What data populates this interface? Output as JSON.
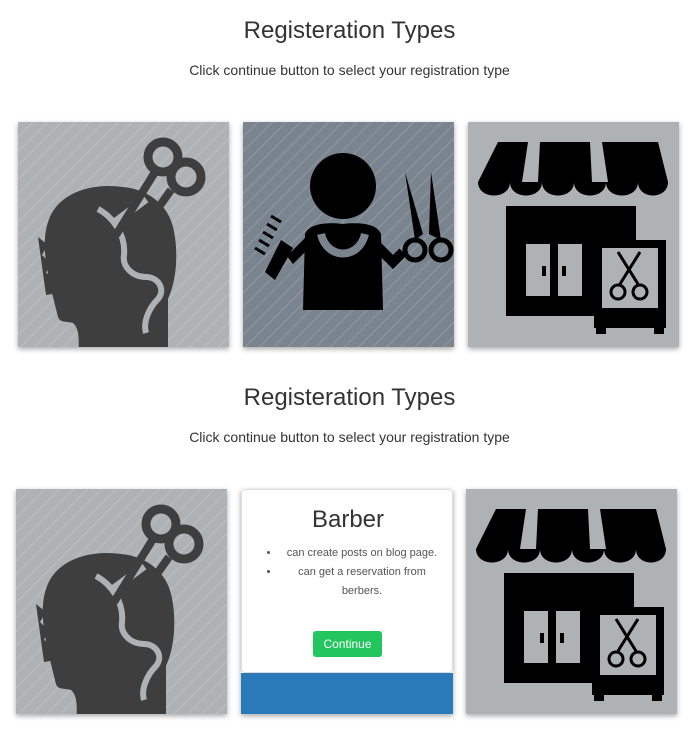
{
  "sections": [
    {
      "title": "Registeration Types",
      "subtitle": "Click continue button to select your registration type",
      "cards": [
        {
          "icon": "hairstyle-head-scissors-icon",
          "bg": "#aeb2b4"
        },
        {
          "icon": "barber-comb-scissors-icon",
          "bg": "#7a848e"
        },
        {
          "icon": "barbershop-storefront-icon",
          "bg": "#aeb2b4"
        }
      ]
    },
    {
      "title": "Registeration Types",
      "subtitle": "Click continue button to select your registration type",
      "cards": [
        {
          "icon": "hairstyle-head-scissors-icon",
          "bg": "#aeb2b4"
        },
        {
          "icon": "barbershop-storefront-icon",
          "bg": "#aeb2b4"
        }
      ],
      "barber_card": {
        "title": "Barber",
        "features": [
          "can create posts on blog page.",
          "can get a reservation from berbers."
        ],
        "button_label": "Continue",
        "button_color": "#22c55e",
        "footer_color": "#2a7ab9"
      }
    }
  ]
}
